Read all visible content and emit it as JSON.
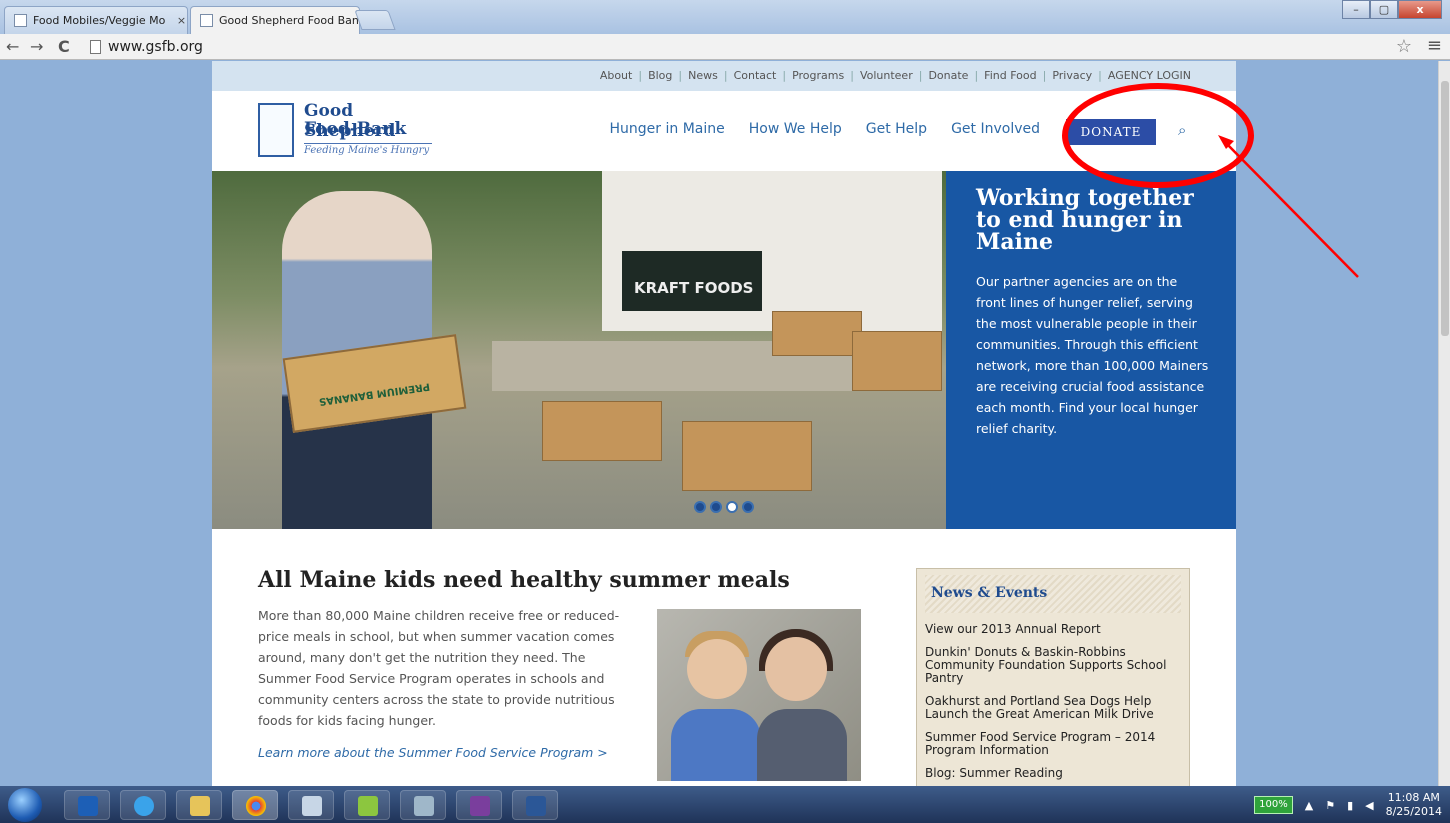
{
  "browser": {
    "tabs": [
      {
        "title": "Food Mobiles/Veggie Mo",
        "close": "×"
      },
      {
        "title": "Good Shepherd Food Ban",
        "close": "×"
      }
    ],
    "url": "www.gsfb.org",
    "back": "←",
    "forward": "→",
    "reload": "C",
    "star": "☆",
    "menu": "≡"
  },
  "site": {
    "utility_links": [
      "About",
      "Blog",
      "News",
      "Contact",
      "Programs",
      "Volunteer",
      "Donate",
      "Find Food",
      "Privacy",
      "AGENCY LOGIN"
    ],
    "logo": {
      "line1": "Good Shepherd",
      "line2": "Food-Bank",
      "tagline": "Feeding Maine's Hungry"
    },
    "main_nav": [
      "Hunger in Maine",
      "How We Help",
      "Get Help",
      "Get Involved"
    ],
    "donate_label": "DONATE",
    "search_glyph": "⌕",
    "hero": {
      "title": "Working together to end hunger in Maine",
      "body": "Our partner agencies are on the front lines of hunger relief, serving the most vulnerable people in their communities. Through this efficient network, more than 100,000 Mainers are receiving crucial food assistance each month. Find your local hunger relief charity.",
      "photo_labels": {
        "truck": "KRAFT FOODS",
        "box": "PREMIUM BANANAS"
      },
      "slides": 4,
      "active_slide": 3
    },
    "story": {
      "title": "All Maine kids need healthy summer meals",
      "body": "More than 80,000 Maine children receive free or reduced-price meals in school, but when summer vacation comes around, many don't get the nutrition they need. The Summer Food Service Program operates in schools and community centers across the state to provide nutritious foods for kids facing hunger.",
      "link": "Learn more about the Summer Food Service Program >"
    },
    "news": {
      "title": "News & Events",
      "items": [
        "View our 2013 Annual Report",
        "Dunkin' Donuts & Baskin-Robbins Community Foundation Supports School Pantry",
        "Oakhurst and Portland Sea Dogs Help Launch the Great American Milk Drive",
        "Summer Food Service Program – 2014 Program Information",
        "Blog: Summer Reading"
      ]
    }
  },
  "taskbar": {
    "battery": "100%",
    "time": "11:08 AM",
    "date": "8/25/2014"
  },
  "colors": {
    "brand_blue": "#1857a4",
    "nav_blue": "#2e6aa7",
    "donate_bg": "#2c4da6",
    "annotation_red": "#ff0000"
  }
}
